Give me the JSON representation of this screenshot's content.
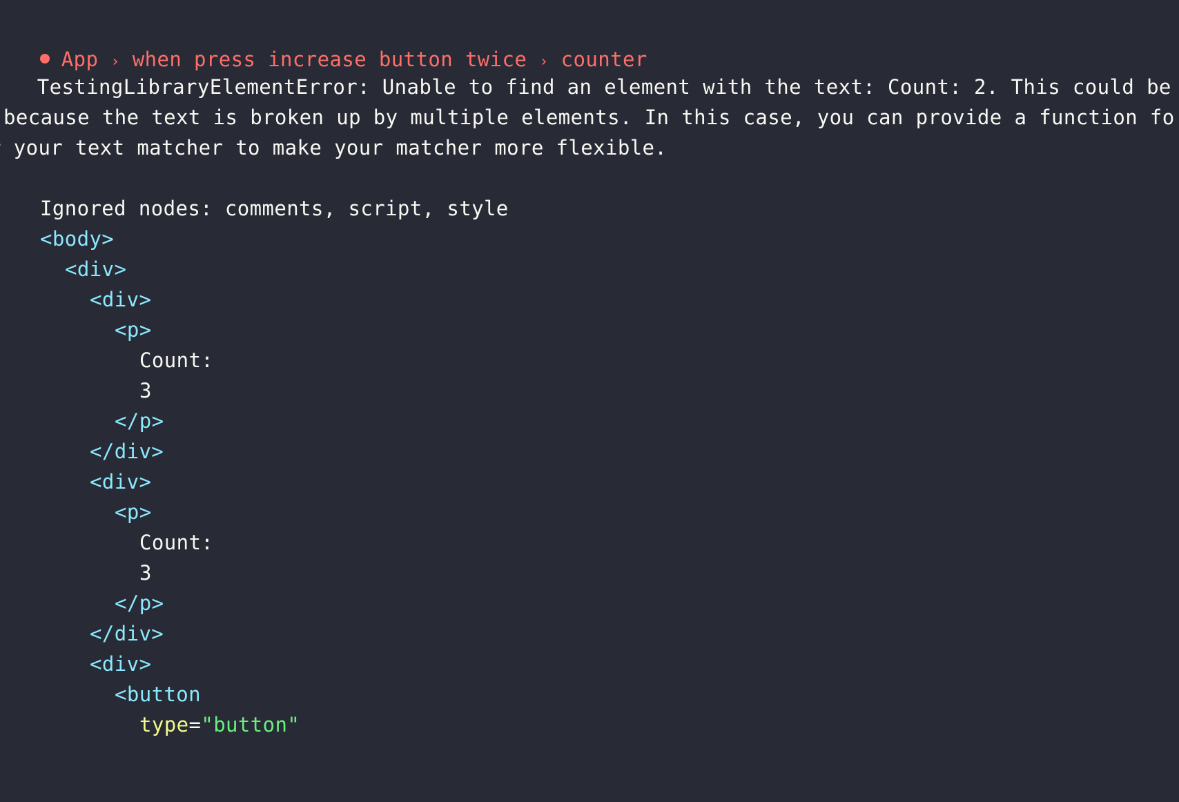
{
  "breadcrumb": {
    "items": [
      "App",
      "when press increase button twice",
      "counter"
    ],
    "separator": "›"
  },
  "error": {
    "lines": [
      "  TestingLibraryElementError: Unable to find an element with the text: Count: 2. This could be",
      "because the text is broken up by multiple elements. In this case, you can provide a function fo",
      "r your text matcher to make your matcher more flexible."
    ]
  },
  "dom": {
    "ignored_label": "Ignored nodes: comments, script, style",
    "body_open": "<body>",
    "div_open": "<div>",
    "div_close": "</div>",
    "p_open": "<p>",
    "p_close": "</p>",
    "count_label": "Count:",
    "count_value": "3",
    "button_open": "<button",
    "attr_name": "type",
    "attr_eq": "=",
    "attr_value": "\"button\""
  },
  "colors": {
    "background": "#282a36",
    "error_red": "#ff6e67",
    "tag_cyan": "#8be9fd",
    "attr_yellow": "#f1fa8c",
    "string_green": "#69f07d"
  }
}
